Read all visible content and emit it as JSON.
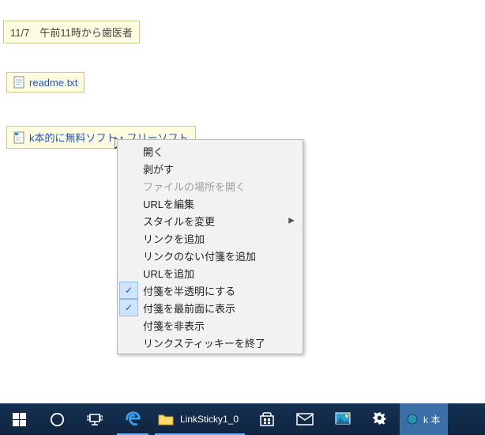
{
  "stickies": {
    "note1": {
      "text": "11/7　午前11時から歯医者"
    },
    "note2": {
      "text": "readme.txt"
    },
    "note3": {
      "text": "k本的に無料ソフト・フリーソフト"
    }
  },
  "menu": {
    "open": "開く",
    "peel": "剥がす",
    "openLocation": "ファイルの場所を開く",
    "editUrl": "URLを編集",
    "changeStyle": "スタイルを変更",
    "addLink": "リンクを追加",
    "addNoLinkSticky": "リンクのない付箋を追加",
    "addUrl": "URLを追加",
    "semiTransparent": "付箋を半透明にする",
    "alwaysOnTop": "付箋を最前面に表示",
    "hideSticky": "付箋を非表示",
    "exit": "リンクスティッキーを終了"
  },
  "taskbar": {
    "folderLabel": "LinkSticky1_0",
    "activeAppLabel": "k 本"
  }
}
